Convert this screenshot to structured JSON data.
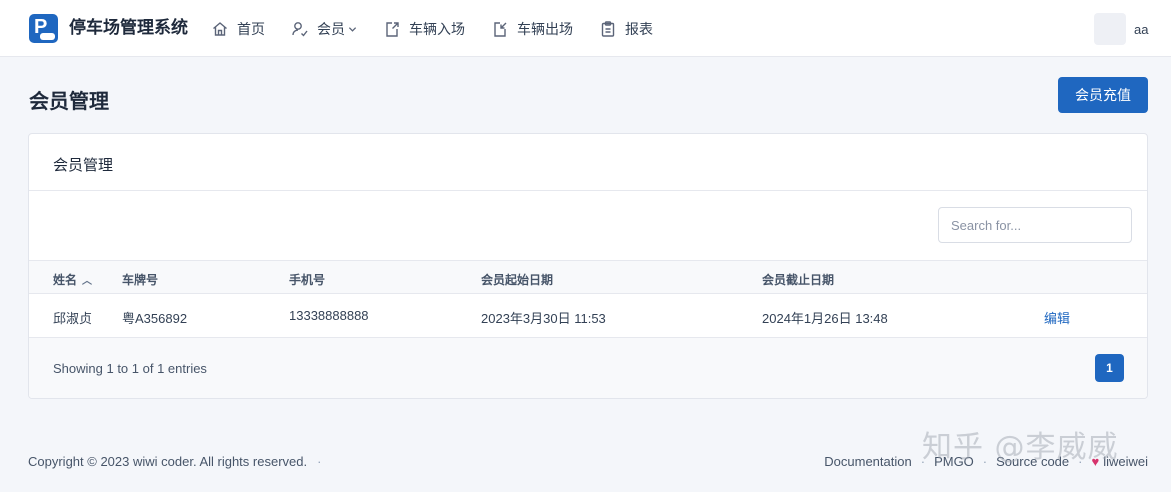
{
  "app": {
    "brand": "停车场管理系统",
    "logo_letter": "P"
  },
  "nav": [
    {
      "label": "首页",
      "icon": "home-icon"
    },
    {
      "label": "会员",
      "icon": "member-icon",
      "has_dropdown": true
    },
    {
      "label": "车辆入场",
      "icon": "car-entry-icon"
    },
    {
      "label": "车辆出场",
      "icon": "car-exit-icon"
    },
    {
      "label": "报表",
      "icon": "report-icon"
    }
  ],
  "user": {
    "name": "aa"
  },
  "page": {
    "title": "会员管理",
    "action_label": "会员充值"
  },
  "card": {
    "title": "会员管理",
    "search_placeholder": "Search for...",
    "columns": [
      "姓名",
      "车牌号",
      "手机号",
      "会员起始日期",
      "会员截止日期"
    ],
    "rows": [
      {
        "name": "邱淑贞",
        "plate": "粤A356892",
        "phone": "13338888888",
        "start": "2023年3月30日 11:53",
        "end": "2024年1月26日 13:48",
        "action": "编辑"
      }
    ],
    "entries_text": "Showing 1 to 1 of 1 entries",
    "current_page": "1"
  },
  "footer": {
    "copyright": "Copyright © 2023 wiwi coder. All rights reserved.",
    "copyright_sep": "·",
    "links": [
      "Documentation",
      "PMGO",
      "Source code"
    ],
    "author": "liweiwei"
  },
  "watermark": "知乎 @李威威",
  "colors": {
    "primary": "#1f67c0",
    "heart": "#d6336c"
  }
}
